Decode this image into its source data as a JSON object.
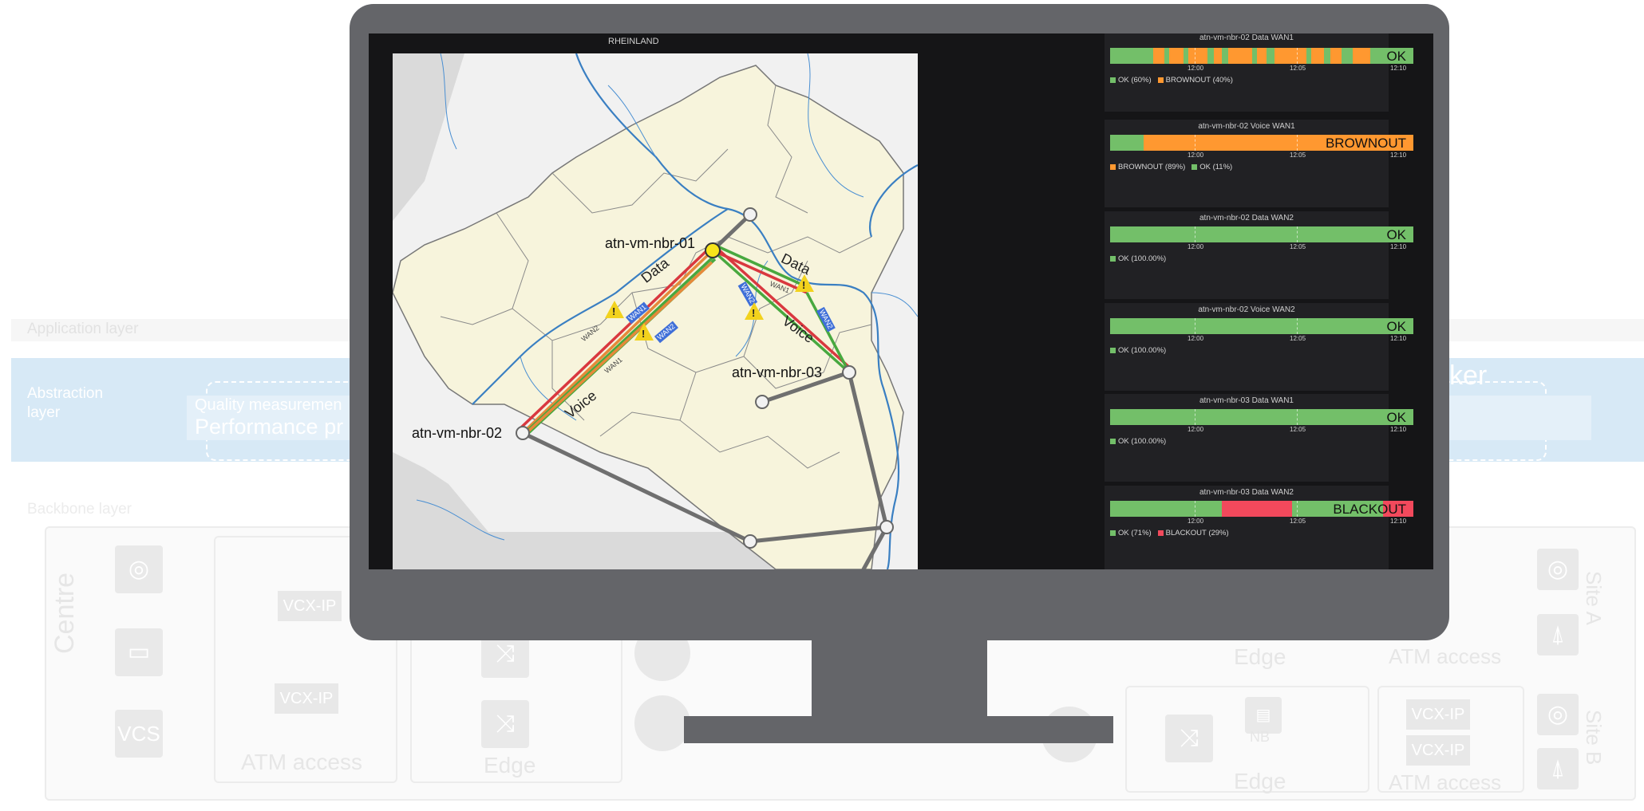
{
  "background": {
    "layers": {
      "application": "Application layer",
      "abstraction": "Abstraction layer",
      "backbone": "Backbone layer"
    },
    "abstraction_box": {
      "quality_label": "Quality measuremen",
      "performance_label": "Performance  pr",
      "broker_fragment": "ker"
    },
    "centre_label": "Centre",
    "vcs_label": "VCS",
    "vcx_ip": "VCX-IP",
    "atm_access": "ATM access",
    "edge": "Edge",
    "nb": "NB",
    "site_a": "Site A",
    "site_b": "Site B"
  },
  "map": {
    "region_label": "RHEINLAND",
    "nodes": {
      "n1": "atn-vm-nbr-01",
      "n2": "atn-vm-nbr-02",
      "n3": "atn-vm-nbr-03"
    },
    "link_labels": {
      "data_left": "Data",
      "voice_left": "Voice",
      "data_right": "Data",
      "voice_right": "Voice"
    },
    "wan_tags": [
      "WAN1",
      "WAN2",
      "WAN2",
      "WAN1",
      "WAN2",
      "WAN1",
      "WAN2"
    ],
    "warning_icon": "warning-triangle-icon"
  },
  "panels": [
    {
      "title": "atn-vm-nbr-02 Data WAN1",
      "state": "OK",
      "legend": [
        {
          "label": "OK (60%)",
          "color": "#73bf69"
        },
        {
          "label": "BROWNOUT (40%)",
          "color": "#ff9830"
        }
      ]
    },
    {
      "title": "atn-vm-nbr-02 Voice WAN1",
      "state": "BROWNOUT",
      "legend": [
        {
          "label": "BROWNOUT (89%)",
          "color": "#ff9830"
        },
        {
          "label": "OK (11%)",
          "color": "#73bf69"
        }
      ]
    },
    {
      "title": "atn-vm-nbr-02 Data WAN2",
      "state": "OK",
      "legend": [
        {
          "label": "OK (100.00%)",
          "color": "#73bf69"
        }
      ]
    },
    {
      "title": "atn-vm-nbr-02 Voice WAN2",
      "state": "OK",
      "legend": [
        {
          "label": "OK (100.00%)",
          "color": "#73bf69"
        }
      ]
    },
    {
      "title": "atn-vm-nbr-03 Data WAN1",
      "state": "OK",
      "legend": [
        {
          "label": "OK (100.00%)",
          "color": "#73bf69"
        }
      ]
    },
    {
      "title": "atn-vm-nbr-03 Data WAN2",
      "state": "BLACKOUT",
      "legend": [
        {
          "label": "OK (71%)",
          "color": "#73bf69"
        },
        {
          "label": "BLACKOUT (29%)",
          "color": "#f2495c"
        }
      ]
    }
  ],
  "ticks": [
    "12:00",
    "12:05",
    "12:10"
  ],
  "colors": {
    "ok": "#73bf69",
    "brownout": "#ff9830",
    "blackout": "#f2495c",
    "monitor": "#646569",
    "screen": "#151517",
    "panel": "#212124"
  }
}
